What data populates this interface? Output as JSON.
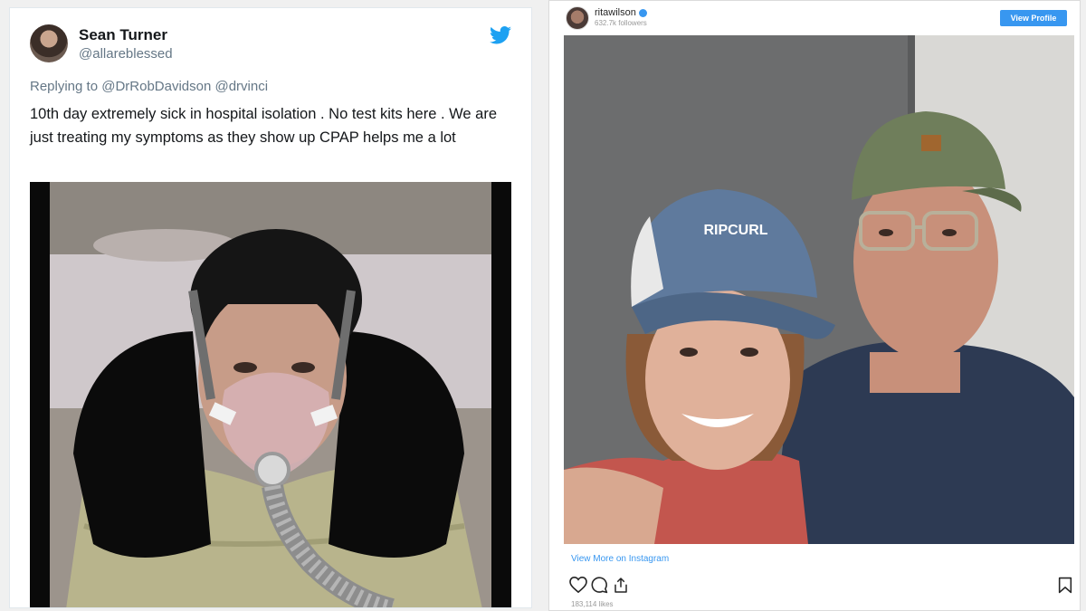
{
  "tweet": {
    "name": "Sean Turner",
    "handle": "@allareblessed",
    "replying_to": "Replying to @DrRobDavidson @drvinci",
    "text": "10th day extremely sick in hospital isolation . No test kits here . We are just treating my symptoms as they show up CPAP helps me a lot",
    "icon": "twitter-bird-icon",
    "accent": "#1da1f2"
  },
  "instagram": {
    "username": "ritawilson",
    "followers": "632.7k followers",
    "view_profile": "View Profile",
    "cap_brand": "RIPCURL",
    "view_more": "View More on Instagram",
    "likes": "183,114 likes",
    "icons": [
      "heart-icon",
      "comment-icon",
      "share-icon",
      "bookmark-icon",
      "verified-badge-icon"
    ],
    "accent": "#3897f0"
  }
}
